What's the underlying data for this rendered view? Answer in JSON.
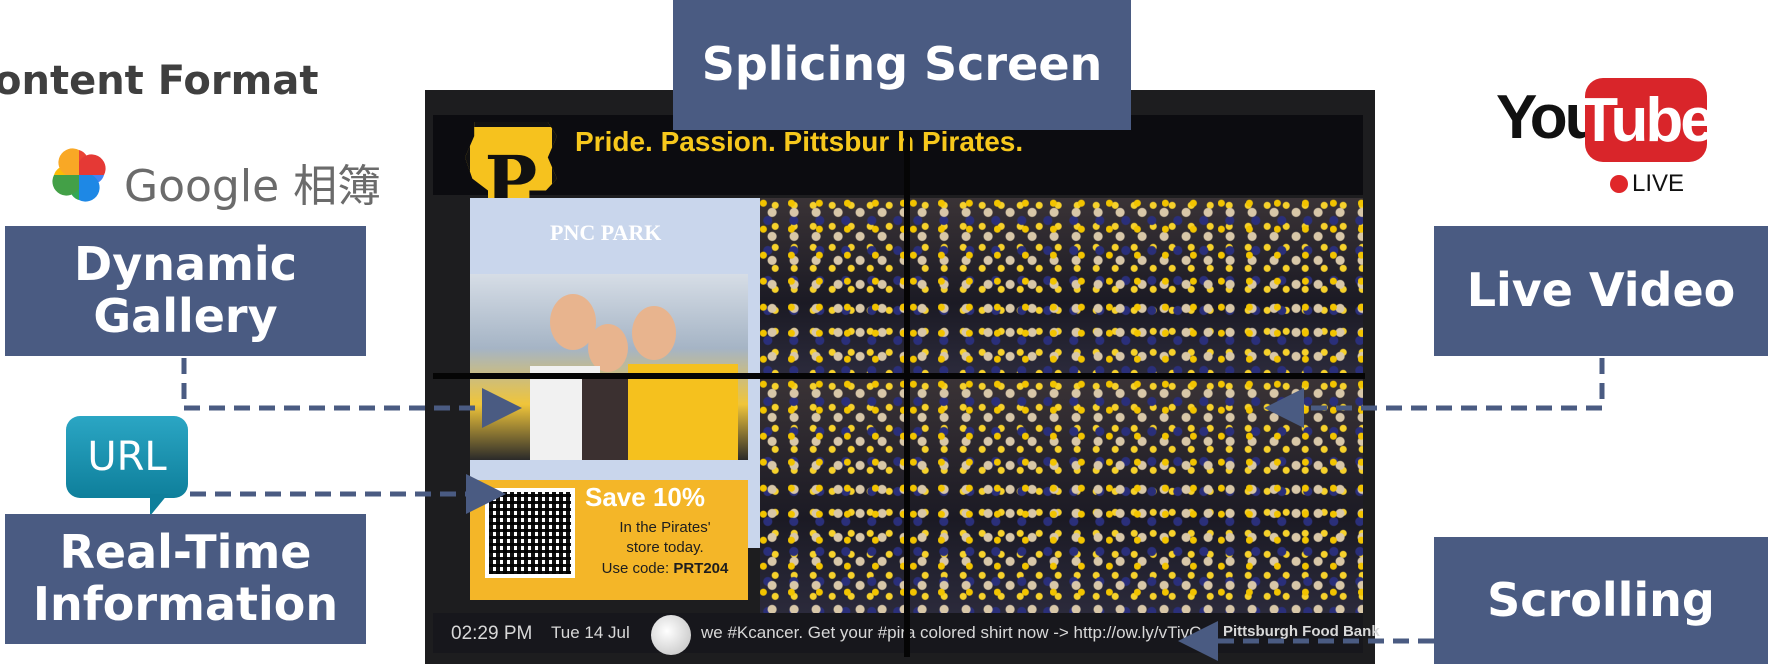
{
  "section_title": "ontent Format",
  "google_photos": {
    "text": "Google 相簿",
    "icon": "google-photos-pinwheel-icon"
  },
  "labels": {
    "dynamic_gallery": [
      "Dynamic",
      "Gallery"
    ],
    "real_time": [
      "Real-Time",
      "Information"
    ],
    "live_video": "Live Video",
    "scrolling": "Scrolling",
    "splicing_screen": "Splicing Screen"
  },
  "url_bubble": "URL",
  "youtube": {
    "you": "You",
    "tube": "Tube",
    "live": "LIVE"
  },
  "screen": {
    "banner": "Pride. Passion. Pittsbur  h Pirates.",
    "logo_letter": "P",
    "park": "PNC PARK",
    "coupon": {
      "headline": "Save 10%",
      "line1": "In the Pirates'",
      "line2": "store today.",
      "code_prefix": "Use code: ",
      "code": "PRT204"
    },
    "ticker": {
      "time": "02:29 PM",
      "date": "Tue 14 Jul",
      "message_1": "we #Kcancer. Get your #pira",
      "message_2": "colored shirt now -> http://ow.ly/vTivC",
      "sponsor": "Pittsburgh Food Bank"
    }
  },
  "colors": {
    "label_box": "#4a5b82",
    "connector": "#4a5b82",
    "pirates_gold": "#f7c81c"
  }
}
